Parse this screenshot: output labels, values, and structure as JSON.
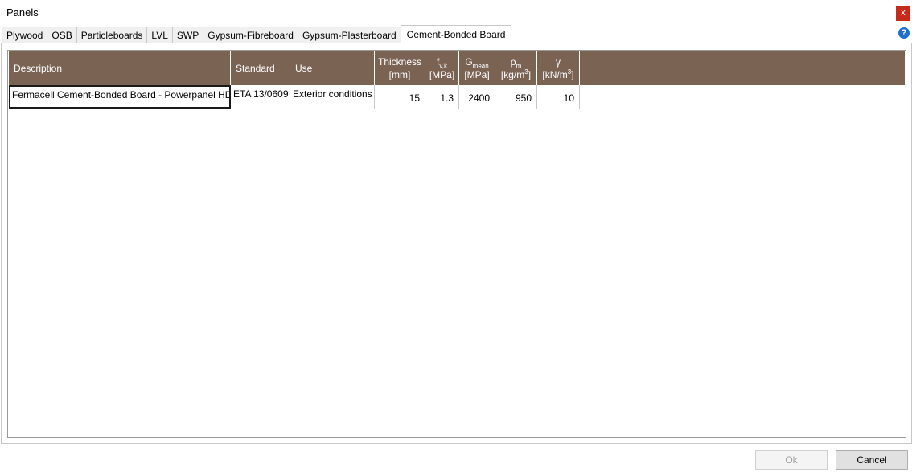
{
  "window": {
    "title": "Panels",
    "close_label": "x",
    "help_label": "?"
  },
  "tabs": [
    {
      "label": "Plywood"
    },
    {
      "label": "OSB"
    },
    {
      "label": "Particleboards"
    },
    {
      "label": "LVL"
    },
    {
      "label": "SWP"
    },
    {
      "label": "Gypsum-Fibreboard"
    },
    {
      "label": "Gypsum-Plasterboard"
    },
    {
      "label": "Cement-Bonded Board",
      "active": true
    }
  ],
  "table": {
    "header_color": "#7b6354",
    "columns": {
      "description": "Description",
      "standard": "Standard",
      "use": "Use",
      "thickness": {
        "name": "Thickness",
        "unit": "[mm]"
      },
      "fvk": {
        "symbol": "f",
        "sub": "v,k",
        "unit": "[MPa]"
      },
      "gmean": {
        "symbol": "G",
        "sub": "mean",
        "unit": "[MPa]"
      },
      "rho": {
        "symbol": "ρ",
        "sub": "m",
        "unit_prefix": "[kg/m",
        "unit_sup": "3",
        "unit_suffix": "]"
      },
      "gamma": {
        "symbol": "γ",
        "unit_prefix": "[kN/m",
        "unit_sup": "3",
        "unit_suffix": "]"
      }
    },
    "rows": [
      {
        "description": "Fermacell Cement-Bonded Board - Powerpanel HD",
        "standard": "ETA 13/0609",
        "use": "Exterior conditions",
        "thickness": "15",
        "fvk": "1.3",
        "gmean": "2400",
        "rho": "950",
        "gamma": "10"
      }
    ]
  },
  "buttons": {
    "ok": "Ok",
    "cancel": "Cancel"
  }
}
